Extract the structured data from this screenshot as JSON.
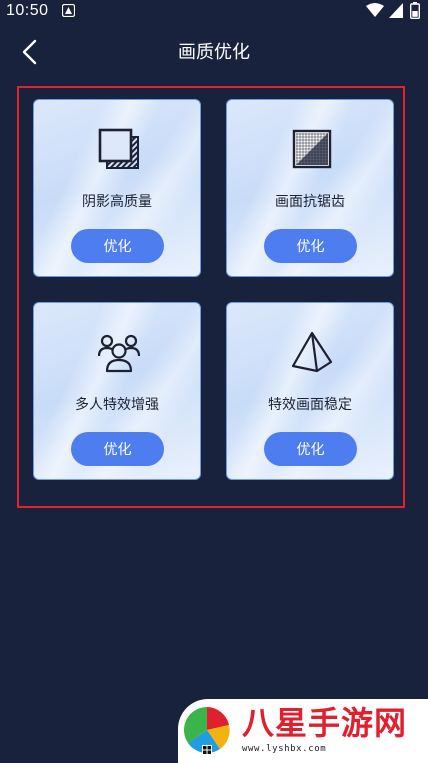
{
  "status_bar": {
    "time": "10:50",
    "icons": [
      "notification-icon",
      "wifi-icon",
      "signal-icon",
      "battery-icon"
    ]
  },
  "header": {
    "title": "画质优化",
    "back_icon": "chevron-left-icon"
  },
  "cards": [
    {
      "label": "阴影高质量",
      "button_label": "优化",
      "icon": "shadow-quality-icon"
    },
    {
      "label": "画面抗锯齿",
      "button_label": "优化",
      "icon": "anti-aliasing-icon"
    },
    {
      "label": "多人特效增强",
      "button_label": "优化",
      "icon": "multi-user-icon"
    },
    {
      "label": "特效画面稳定",
      "button_label": "优化",
      "icon": "pyramid-icon"
    }
  ],
  "colors": {
    "background": "#19223d",
    "accent_button": "#4e7df0",
    "highlight_frame": "#e3232c",
    "card_border": "#6f9be4"
  },
  "watermark": {
    "title": "八星手游网",
    "url": "www.lyshbx.com"
  }
}
